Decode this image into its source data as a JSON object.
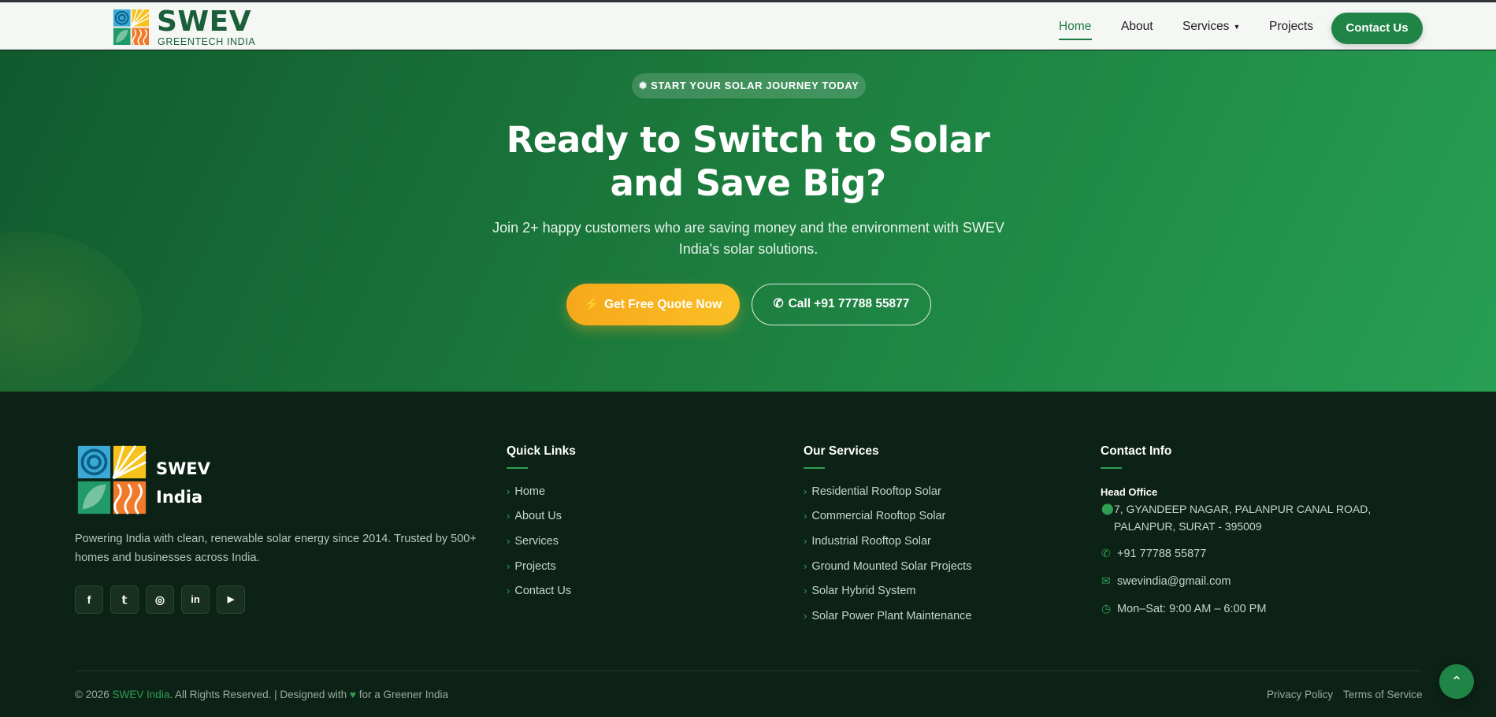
{
  "header": {
    "brand": "SWEV",
    "brand_sub": "GREENTECH INDIA",
    "nav": {
      "home": "Home",
      "about": "About",
      "services": "Services",
      "services_caret": "▼",
      "projects": "Projects"
    },
    "contact_button": "Contact Us"
  },
  "hero": {
    "badge_icon": "❅",
    "badge": "START YOUR SOLAR JOURNEY TODAY",
    "title_line1": "Ready to Switch to Solar",
    "title_line2": "and Save Big?",
    "subtitle": "Join 2+ happy customers who are saving money and the environment with SWEV India's solar solutions.",
    "quote_icon": "⚡",
    "quote_button": "Get Free Quote Now",
    "call_icon": "✆",
    "call_button": "Call +91 77788 55877"
  },
  "footer": {
    "brand_line1": "SWEV",
    "brand_line2": "India",
    "description": "Powering India with clean, renewable solar energy since 2014. Trusted by 500+ homes and businesses across India.",
    "social": [
      {
        "name": "facebook-icon",
        "glyph": "f"
      },
      {
        "name": "twitter-icon",
        "glyph": "𝕥"
      },
      {
        "name": "instagram-icon",
        "glyph": "◎"
      },
      {
        "name": "linkedin-icon",
        "glyph": "in"
      },
      {
        "name": "youtube-icon",
        "glyph": "▶"
      }
    ],
    "quick_links": {
      "title": "Quick Links",
      "items": [
        "Home",
        "About Us",
        "Services",
        "Projects",
        "Contact Us"
      ]
    },
    "services": {
      "title": "Our Services",
      "items": [
        "Residential Rooftop Solar",
        "Commercial Rooftop Solar",
        "Industrial Rooftop Solar",
        "Ground Mounted Solar Projects",
        "Solar Hybrid System",
        "Solar Power Plant Maintenance"
      ]
    },
    "contact": {
      "title": "Contact Info",
      "head_office": "Head Office",
      "address": "7, GYANDEEP NAGAR, PALANPUR CANAL ROAD, PALANPUR, SURAT - 395009",
      "phone": "+91 77788 55877",
      "email": "swevindia@gmail.com",
      "hours": "Mon–Sat: 9:00 AM – 6:00 PM"
    },
    "copyright_prefix": "© 2026",
    "copyright_brand": "SWEV India",
    "copyright_suffix": ". All Rights Reserved. | Designed with",
    "copyright_heart": "♥",
    "copyright_end": "for a Greener India",
    "privacy": "Privacy Policy",
    "terms": "Terms of Service",
    "back_to_top": "⌃"
  },
  "colors": {
    "primary_green": "#1f8445",
    "accent_orange": "#fbbf24",
    "footer_bg": "#0c2216"
  }
}
